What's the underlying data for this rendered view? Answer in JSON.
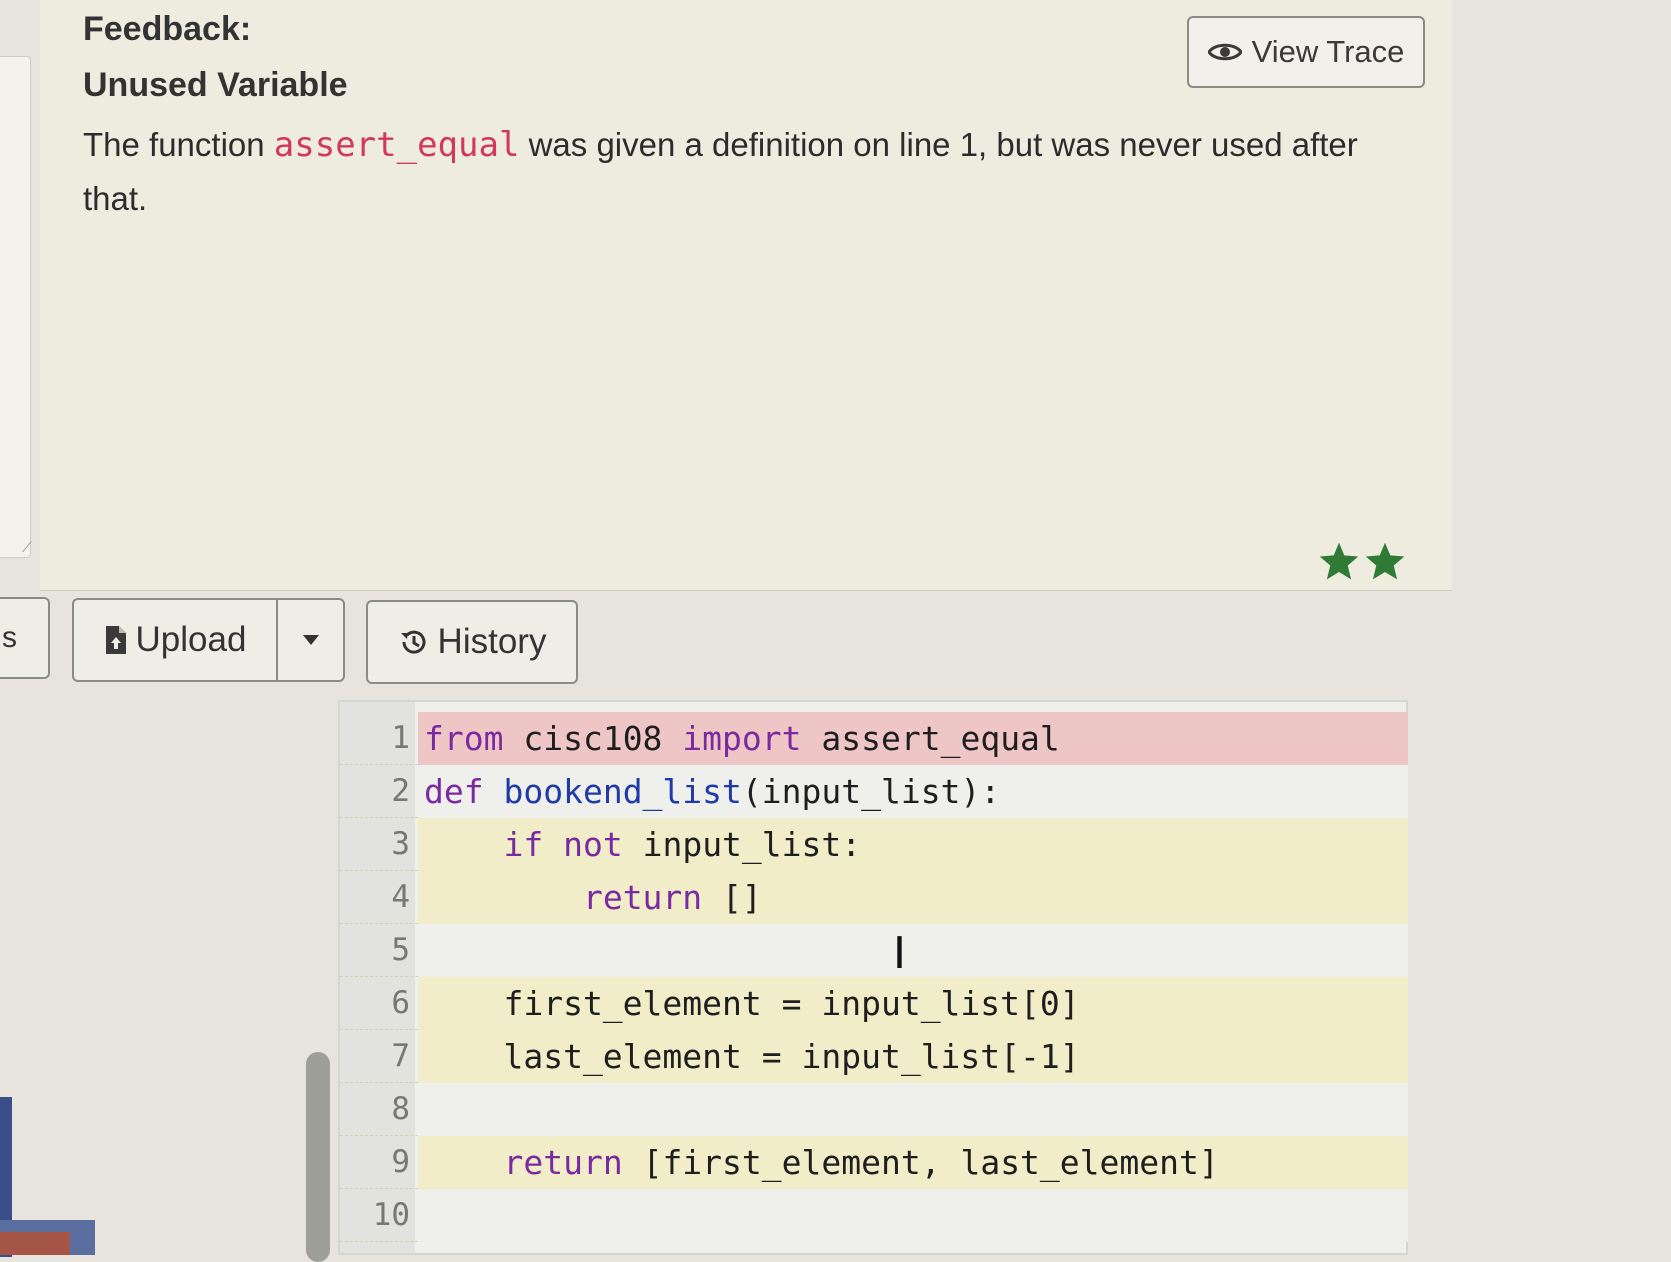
{
  "feedback": {
    "heading": "Feedback:",
    "subheading": "Unused Variable",
    "message_prefix": "The function ",
    "message_code": "assert_equal",
    "message_suffix": " was given a definition on line 1, but was never used after that.",
    "view_trace_label": "View Trace",
    "stars_count": 2,
    "star_color": "#2f7a35"
  },
  "toolbar": {
    "left_partial_label": "s",
    "upload_label": "Upload",
    "history_label": "History"
  },
  "editor": {
    "lines": [
      {
        "number": "1",
        "highlight": "red"
      },
      {
        "number": "2",
        "highlight": "none"
      },
      {
        "number": "3",
        "highlight": "yellow"
      },
      {
        "number": "4",
        "highlight": "yellow"
      },
      {
        "number": "5",
        "highlight": "none"
      },
      {
        "number": "6",
        "highlight": "yellow"
      },
      {
        "number": "7",
        "highlight": "yellow"
      },
      {
        "number": "8",
        "highlight": "none"
      },
      {
        "number": "9",
        "highlight": "yellow"
      },
      {
        "number": "10",
        "highlight": "none"
      }
    ],
    "code": {
      "l1_kw1": "from",
      "l1_mid": " cisc108 ",
      "l1_kw2": "import",
      "l1_end": " assert_equal",
      "l2_kw": "def",
      "l2_fn": "bookend_list",
      "l2_end": "(input_list):",
      "l3_indent": "    ",
      "l3_kw1": "if",
      "l3_kw2": "not",
      "l3_end": " input_list:",
      "l4_indent": "        ",
      "l4_kw": "return",
      "l4_end": " []",
      "l6": "    first_element = input_list[0]",
      "l7": "    last_element = input_list[-1]",
      "l9_indent": "    ",
      "l9_kw": "return",
      "l9_end": " [first_element, last_element]"
    }
  }
}
